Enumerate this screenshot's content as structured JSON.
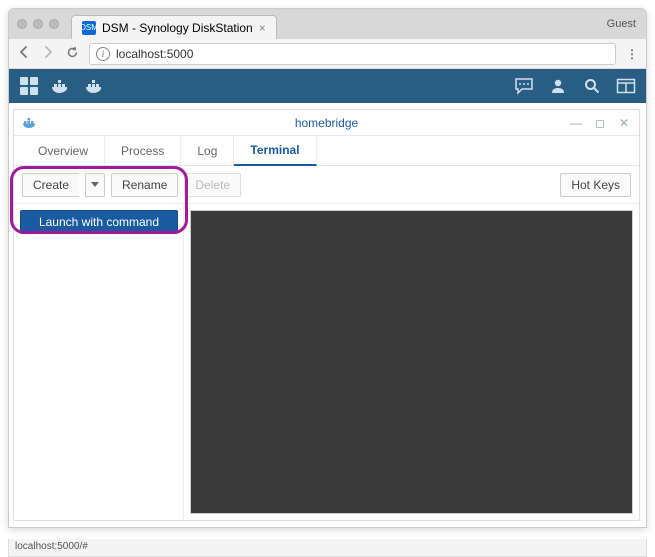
{
  "browser": {
    "tab_title": "DSM - Synology DiskStation",
    "guest_label": "Guest",
    "url": "localhost:5000",
    "status_text": "localhost:5000/#"
  },
  "window": {
    "title": "homebridge",
    "tabs": [
      {
        "label": "Overview"
      },
      {
        "label": "Process"
      },
      {
        "label": "Log"
      },
      {
        "label": "Terminal"
      }
    ],
    "active_tab_index": 3
  },
  "toolbar": {
    "create_label": "Create",
    "rename_label": "Rename",
    "delete_label": "Delete",
    "hotkeys_label": "Hot Keys",
    "dropdown": {
      "launch_with_command": "Launch with command"
    }
  }
}
